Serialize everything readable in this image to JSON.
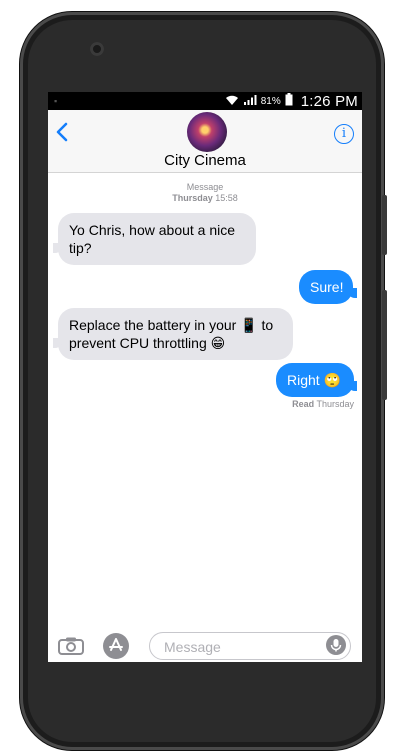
{
  "status": {
    "battery_percent": "81%",
    "time": "1:26 PM"
  },
  "header": {
    "contact_name": "City Cinema",
    "back_glyph": "<",
    "info_glyph": "i"
  },
  "thread": {
    "service_label": "Message",
    "date_day": "Thursday",
    "date_time": "15:58",
    "messages": [
      {
        "direction": "incoming",
        "text": "Yo Chris, how about a nice tip?"
      },
      {
        "direction": "outgoing",
        "text": "Sure!"
      },
      {
        "direction": "incoming",
        "text": "Replace the battery in your 📱 to prevent CPU throttling 😁"
      },
      {
        "direction": "outgoing",
        "text": "Right 🙄"
      }
    ],
    "read_label": "Read",
    "read_day": "Thursday"
  },
  "composer": {
    "placeholder": "Message"
  },
  "colors": {
    "accent": "#147efb",
    "outgoing_bubble": "#1a8cff",
    "incoming_bubble": "#e5e5ea",
    "phone_body": "#2b2b2b"
  },
  "icons": [
    "wifi-icon",
    "signal-icon",
    "battery-icon",
    "camera-icon",
    "app-store-icon",
    "microphone-icon",
    "info-icon",
    "back-chevron-icon"
  ]
}
